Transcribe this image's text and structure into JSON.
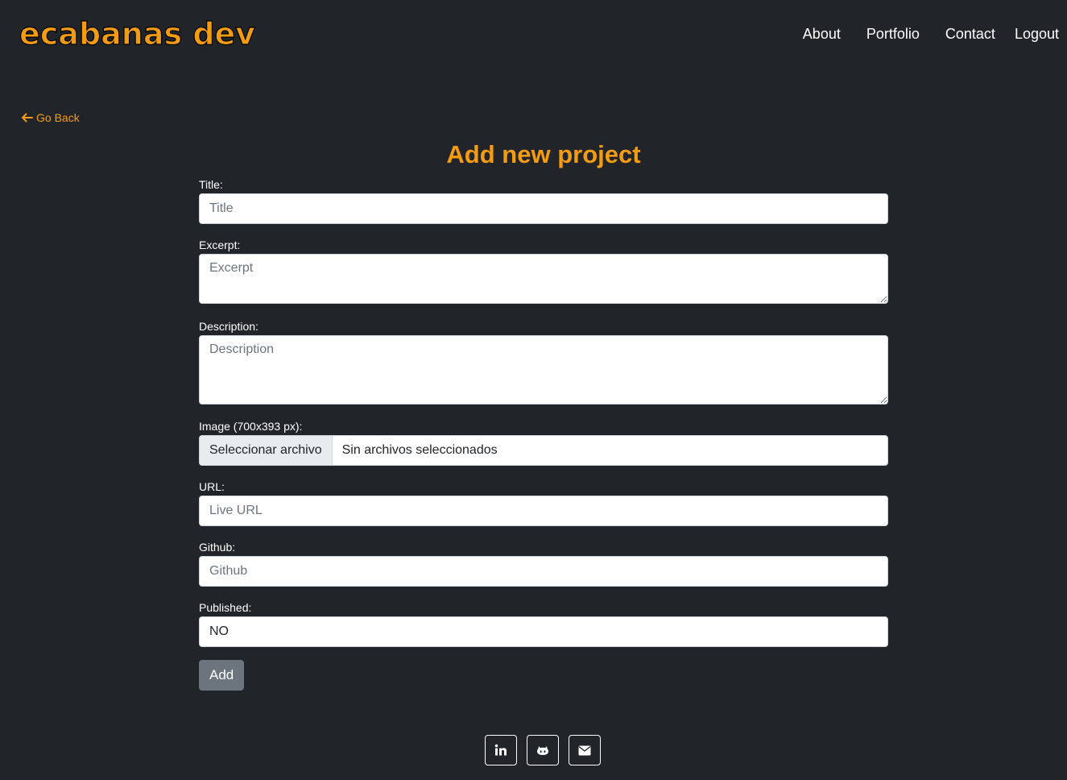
{
  "header": {
    "brand": "ecabanas dev",
    "nav": {
      "about": "About",
      "portfolio": "Portfolio",
      "contact": "Contact",
      "logout": "Logout"
    }
  },
  "go_back": {
    "label": "Go Back",
    "icon": "arrow-left-icon"
  },
  "page": {
    "title": "Add new project"
  },
  "form": {
    "title": {
      "label": "Title:",
      "placeholder": "Title",
      "value": ""
    },
    "excerpt": {
      "label": "Excerpt:",
      "placeholder": "Excerpt",
      "value": ""
    },
    "description": {
      "label": "Description:",
      "placeholder": "Description",
      "value": ""
    },
    "image": {
      "label": "Image (700x393 px):",
      "button": "Seleccionar archivo",
      "status": "Sin archivos seleccionados"
    },
    "url": {
      "label": "URL:",
      "placeholder": "Live URL",
      "value": ""
    },
    "github": {
      "label": "Github:",
      "placeholder": "Github",
      "value": ""
    },
    "published": {
      "label": "Published:",
      "value": "NO"
    },
    "submit": "Add"
  },
  "footer": {
    "icons": [
      "linkedin-icon",
      "github-icon",
      "envelope-icon"
    ]
  },
  "colors": {
    "background": "#212529",
    "accent": "#f39c12",
    "button": "#6c757d"
  }
}
